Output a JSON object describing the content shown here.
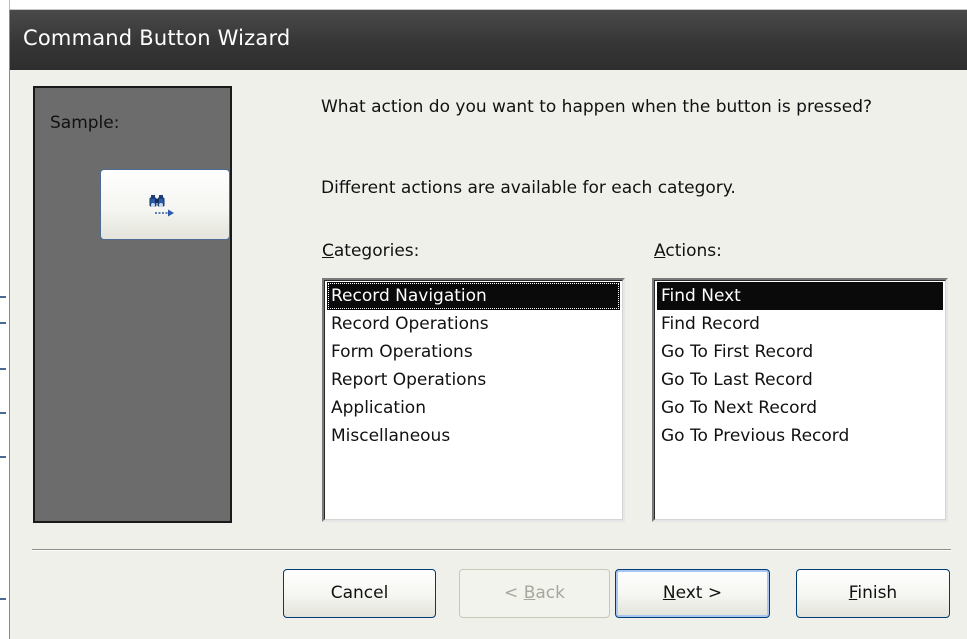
{
  "window": {
    "title": "Command Button Wizard"
  },
  "sample": {
    "label": "Sample:",
    "button_icon": "binoculars-find-next-icon"
  },
  "prompt": {
    "question": "What action do you want to happen when the button is pressed?",
    "info": "Different actions are available for each category."
  },
  "categories": {
    "label_prefix": "",
    "label_accel": "C",
    "label_rest": "ategories:",
    "items": [
      {
        "label": "Record Navigation",
        "selected": true
      },
      {
        "label": "Record Operations",
        "selected": false
      },
      {
        "label": "Form Operations",
        "selected": false
      },
      {
        "label": "Report Operations",
        "selected": false
      },
      {
        "label": "Application",
        "selected": false
      },
      {
        "label": "Miscellaneous",
        "selected": false
      }
    ]
  },
  "actions": {
    "label_accel": "A",
    "label_rest": "ctions:",
    "items": [
      {
        "label": "Find Next",
        "selected": true
      },
      {
        "label": "Find Record",
        "selected": false
      },
      {
        "label": "Go To First Record",
        "selected": false
      },
      {
        "label": "Go To Last Record",
        "selected": false
      },
      {
        "label": "Go To Next Record",
        "selected": false
      },
      {
        "label": "Go To Previous Record",
        "selected": false
      }
    ]
  },
  "buttons": {
    "cancel": "Cancel",
    "back_prefix": "< ",
    "back_accel": "B",
    "back_rest": "ack",
    "next_accel": "N",
    "next_rest": "ext >",
    "finish_accel": "F",
    "finish_rest": "inish",
    "back_enabled": false
  },
  "colors": {
    "titlebar": "#363636",
    "sample_panel": "#6c6c6c",
    "selection": "#0a0a0a",
    "dialog_bg": "#f0f0eb"
  }
}
